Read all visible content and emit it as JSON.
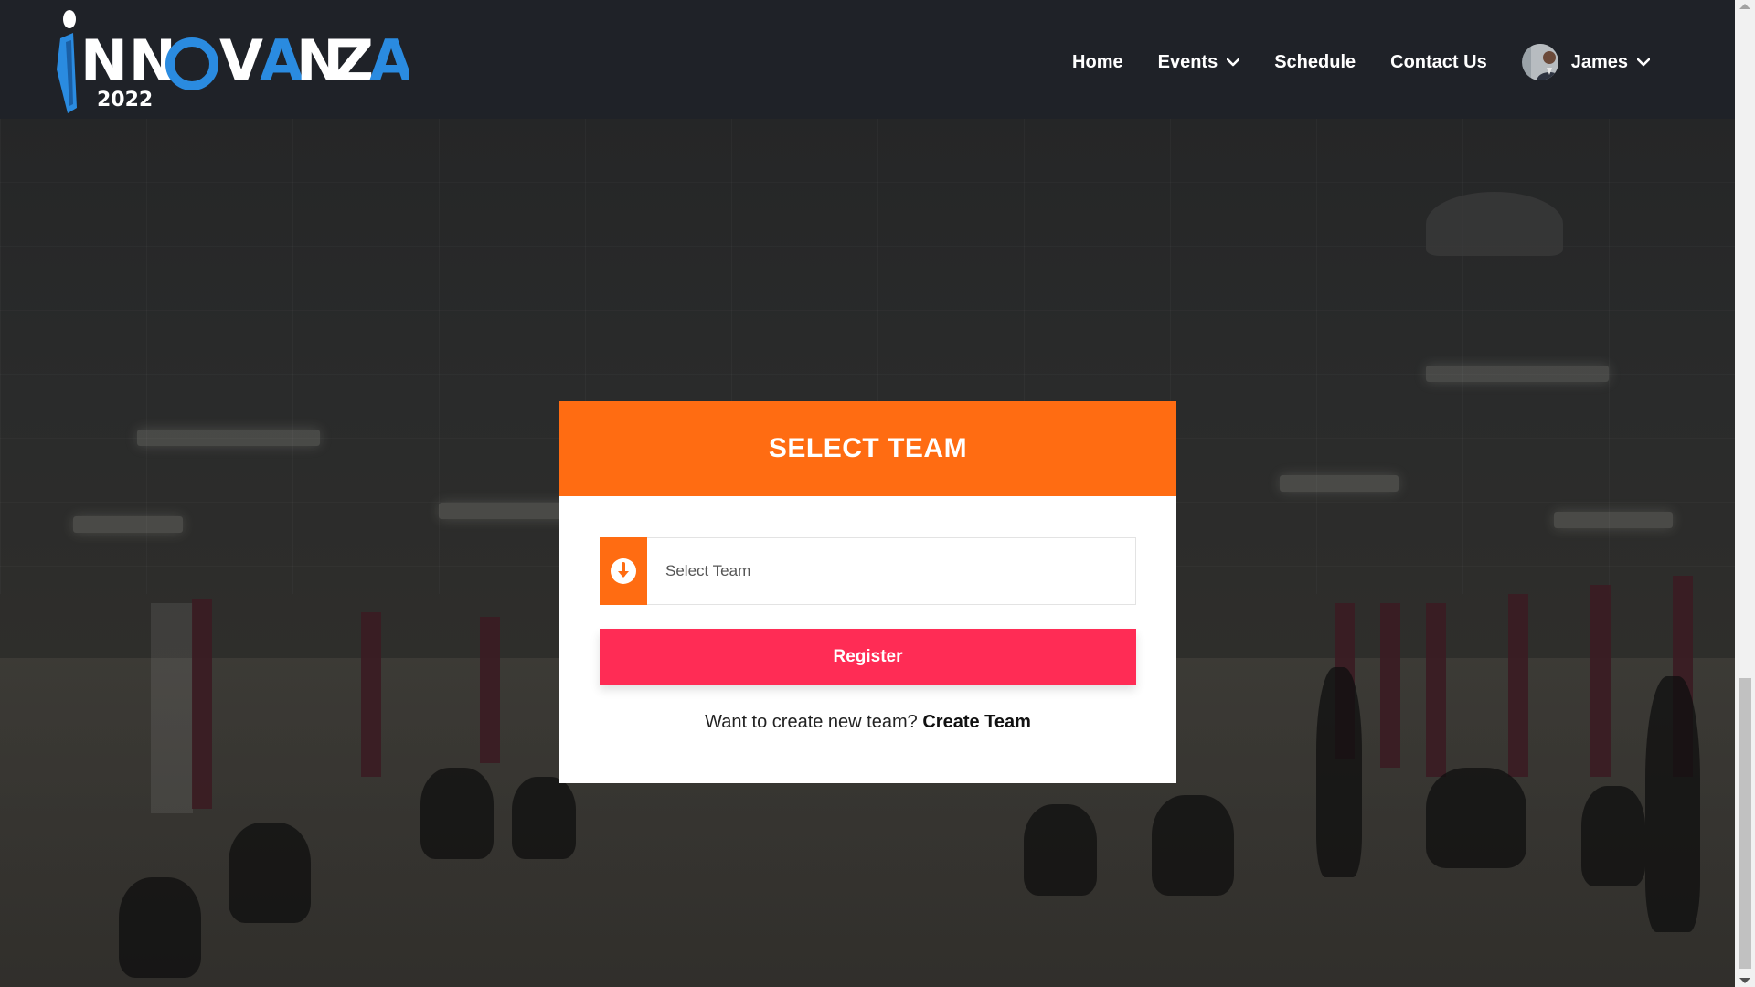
{
  "brand": {
    "logo_text": "INNOVANZA",
    "logo_year": "2022",
    "colors": {
      "blue": "#2a8be0",
      "white": "#ffffff"
    }
  },
  "nav": {
    "items": [
      {
        "label": "Home",
        "has_dropdown": false
      },
      {
        "label": "Events",
        "has_dropdown": true
      },
      {
        "label": "Schedule",
        "has_dropdown": false
      },
      {
        "label": "Contact Us",
        "has_dropdown": false
      }
    ],
    "user": {
      "name": "James",
      "has_dropdown": true,
      "icon": "avatar"
    }
  },
  "card": {
    "title": "SELECT TEAM",
    "select": {
      "placeholder": "Select Team",
      "icon": "arrow-down-circle-icon"
    },
    "register_label": "Register",
    "prompt_text": "Want to create new team?",
    "create_link": "Create Team"
  },
  "theme": {
    "header_bg": "#1f2228",
    "accent_orange": "#ff6c12",
    "accent_pink": "#ff2c55"
  }
}
